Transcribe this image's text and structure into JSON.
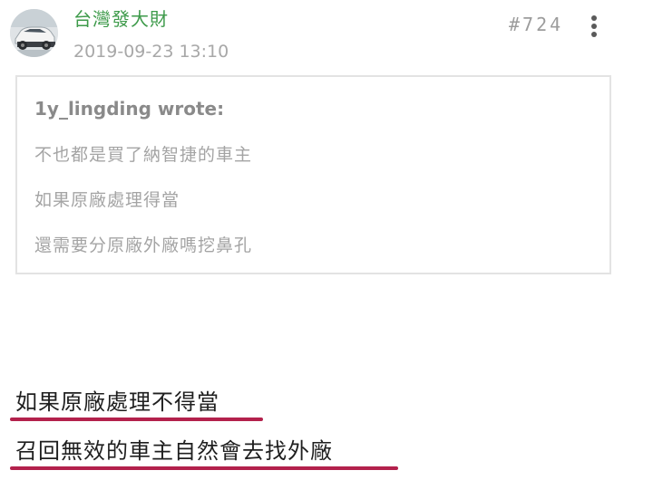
{
  "post": {
    "author": "台灣發大財",
    "timestamp": "2019-09-23 13:10",
    "floor_number": "#724",
    "avatar_icon": "car-avatar-icon",
    "more_icon": "more-vertical-icon"
  },
  "quote": {
    "author_line": "1y_lingding wrote:",
    "lines": [
      "不也都是買了納智捷的車主",
      "如果原廠處理得當",
      "還需要分原廠外廠嗎挖鼻孔"
    ]
  },
  "reply": {
    "lines": [
      "如果原廠處理不得當",
      "召回無效的車主自然會去找外廠"
    ],
    "underline_color": "#b3214c"
  },
  "colors": {
    "username": "#3d9a4a",
    "timestamp": "#a8a8a8",
    "quote_border": "#e3e3e3",
    "reply_text": "#1f1f1f"
  }
}
